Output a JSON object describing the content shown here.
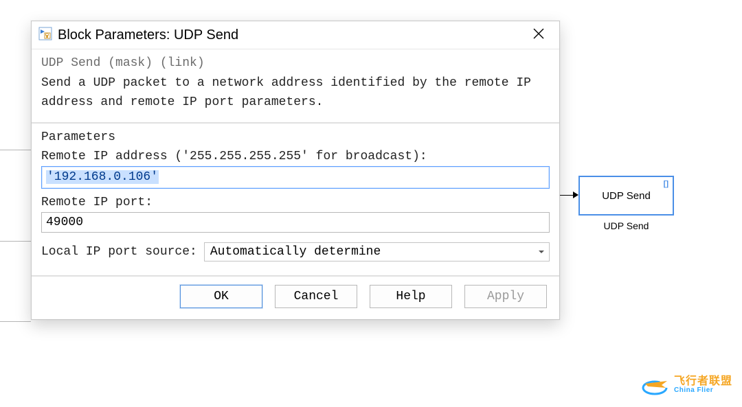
{
  "dialog": {
    "title": "Block Parameters: UDP Send",
    "mask_line": "UDP Send (mask) (link)",
    "description": "Send a UDP packet to a network address identified by the remote IP address and remote IP port parameters.",
    "section_heading": "Parameters",
    "fields": {
      "remote_ip_label": "Remote IP address ('255.255.255.255' for broadcast):",
      "remote_ip_value": "'192.168.0.106'",
      "remote_port_label": "Remote IP port:",
      "remote_port_value": "49000",
      "local_port_source_label": "Local IP port source:",
      "local_port_source_value": "Automatically determine"
    },
    "buttons": {
      "ok": "OK",
      "cancel": "Cancel",
      "help": "Help",
      "apply": "Apply"
    }
  },
  "canvas": {
    "block_label": "UDP Send",
    "block_name": "UDP Send",
    "delay_badge": "[]"
  },
  "logo": {
    "cn": "飞行者联盟",
    "en": "China Flier"
  }
}
